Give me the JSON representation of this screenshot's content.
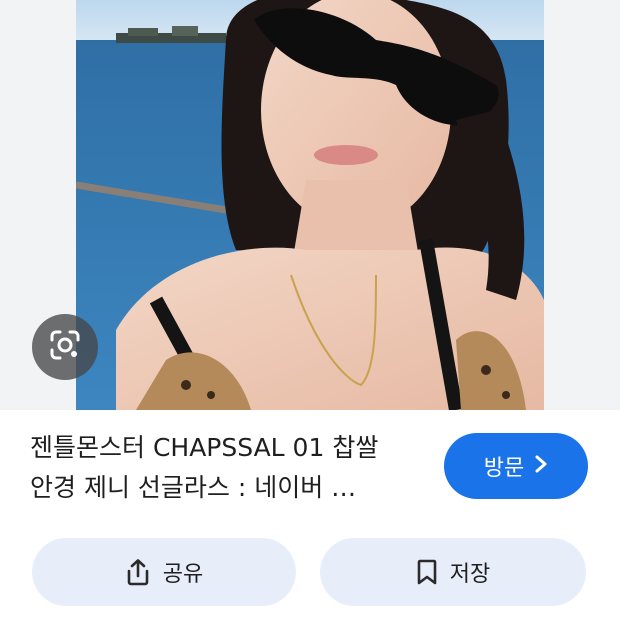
{
  "result": {
    "title": "젠틀몬스터 CHAPSSAL 01 찹쌀 안경 제니 선글라스 : 네이버 …"
  },
  "visit_button": {
    "label": "방문",
    "icon": "chevron-right-icon"
  },
  "actions": {
    "share_label": "공유",
    "share_icon": "share-icon",
    "save_label": "저장",
    "save_icon": "bookmark-icon"
  },
  "lens_icon": "google-lens-icon",
  "colors": {
    "accent": "#1a73e8",
    "action_bg": "#e8eef9",
    "text": "#1f1f1f"
  }
}
